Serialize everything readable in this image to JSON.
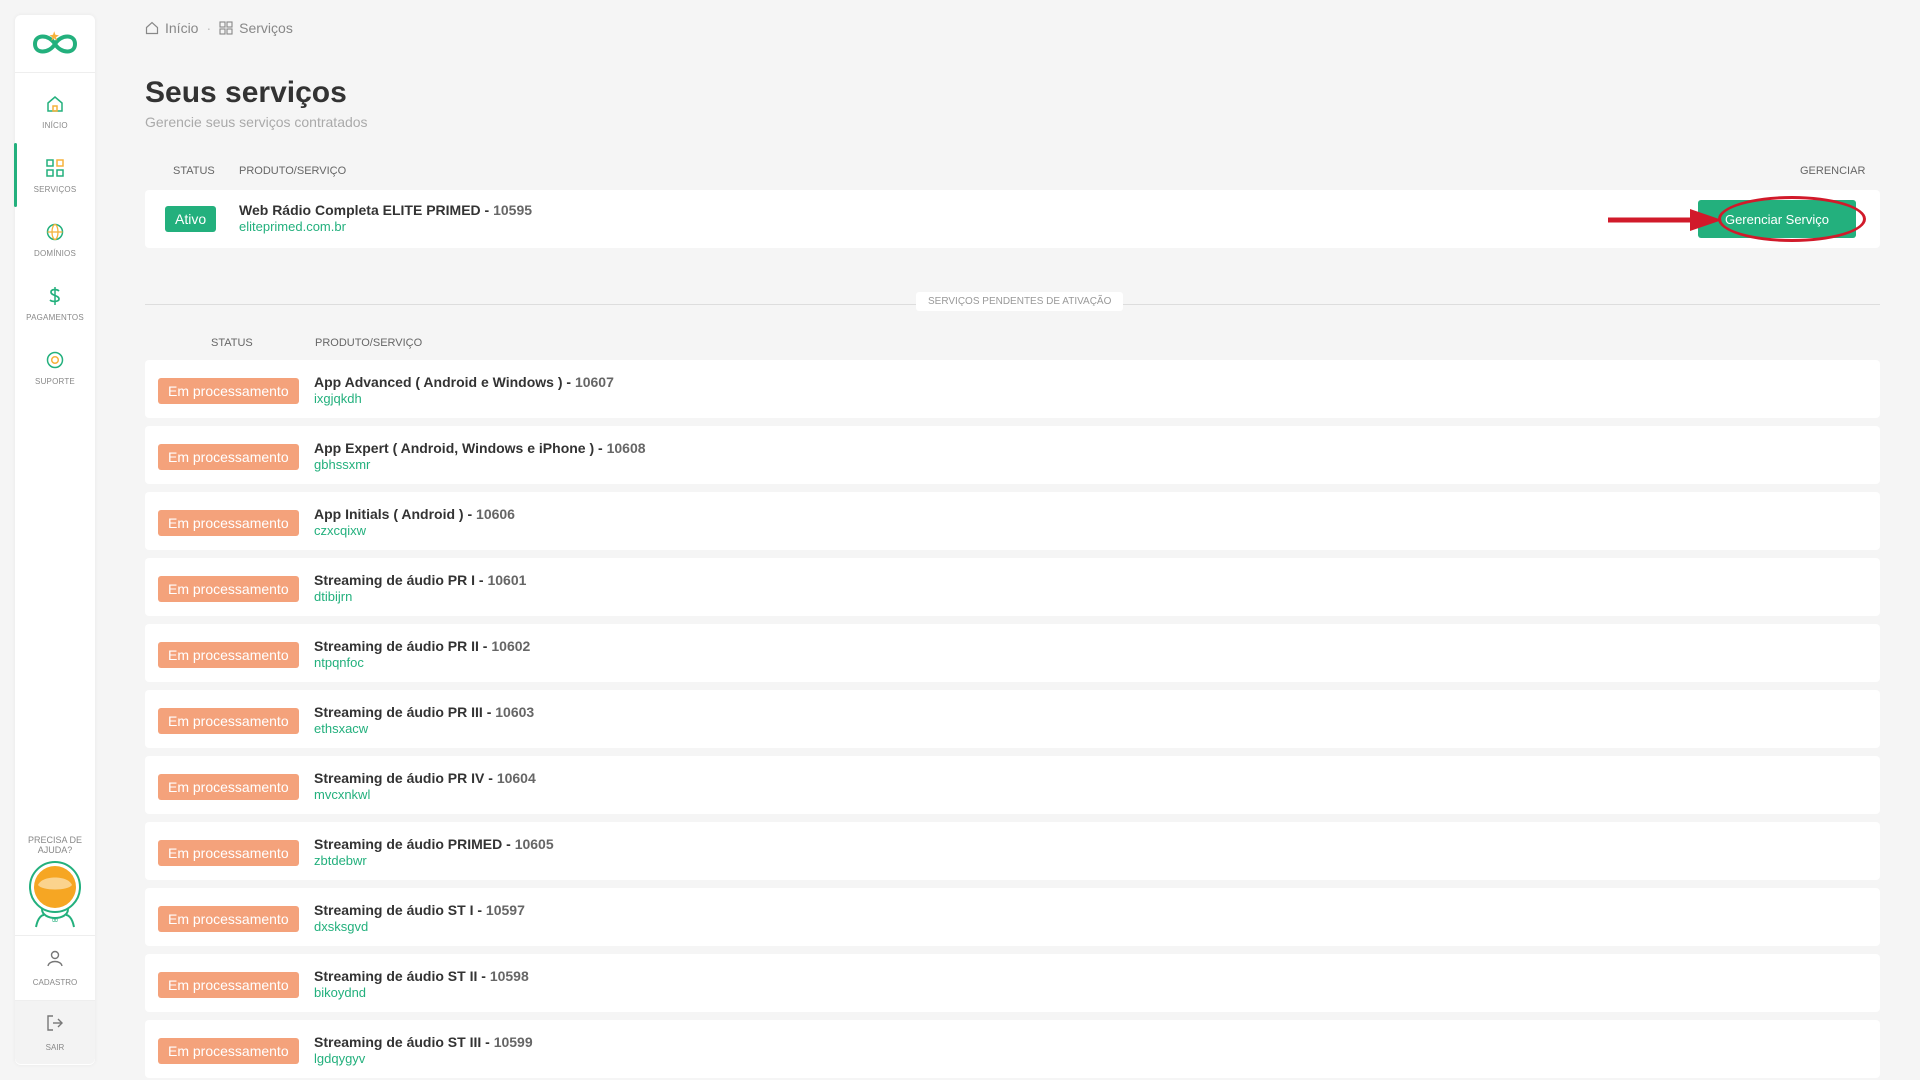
{
  "sidebar": {
    "items": [
      {
        "name": "inicio",
        "label": "INÍCIO",
        "icon": "home-icon"
      },
      {
        "name": "servicos",
        "label": "SERVIÇOS",
        "icon": "grid-icon"
      },
      {
        "name": "dominios",
        "label": "DOMÍNIOS",
        "icon": "globe-icon"
      },
      {
        "name": "pagamentos",
        "label": "PAGAMENTOS",
        "icon": "dollar-icon"
      },
      {
        "name": "suporte",
        "label": "SUPORTE",
        "icon": "lifebuoy-icon"
      }
    ],
    "help": "PRECISA DE AJUDA?",
    "cadastro": "CADASTRO",
    "sair": "SAIR"
  },
  "breadcrumb": {
    "home": "Início",
    "current": "Serviços"
  },
  "header": {
    "title": "Seus serviços",
    "subtitle": "Gerencie seus serviços contratados"
  },
  "active_table": {
    "col_status": "STATUS",
    "col_product": "PRODUTO/SERVIÇO",
    "col_manage": "GERENCIAR",
    "row": {
      "status": "Ativo",
      "name": "Web Rádio Completa ELITE PRIMED",
      "code": "10595",
      "domain": "eliteprimed.com.br",
      "button": "Gerenciar Serviço"
    }
  },
  "pending_label": "SERVIÇOS PENDENTES DE ATIVAÇÃO",
  "pending_table": {
    "col_status": "STATUS",
    "col_product": "PRODUTO/SERVIÇO",
    "rows": [
      {
        "status": "Em processamento",
        "name": "App Advanced ( Android e Windows )",
        "code": "10607",
        "domain": "ixgjqkdh"
      },
      {
        "status": "Em processamento",
        "name": "App Expert ( Android, Windows e iPhone )",
        "code": "10608",
        "domain": "gbhssxmr"
      },
      {
        "status": "Em processamento",
        "name": "App Initials ( Android )",
        "code": "10606",
        "domain": "czxcqixw"
      },
      {
        "status": "Em processamento",
        "name": "Streaming de áudio PR I",
        "code": "10601",
        "domain": "dtibijrn"
      },
      {
        "status": "Em processamento",
        "name": "Streaming de áudio PR II",
        "code": "10602",
        "domain": "ntpqnfoc"
      },
      {
        "status": "Em processamento",
        "name": "Streaming de áudio PR III",
        "code": "10603",
        "domain": "ethsxacw"
      },
      {
        "status": "Em processamento",
        "name": "Streaming de áudio PR IV",
        "code": "10604",
        "domain": "mvcxnkwl"
      },
      {
        "status": "Em processamento",
        "name": "Streaming de áudio PRIMED",
        "code": "10605",
        "domain": "zbtdebwr"
      },
      {
        "status": "Em processamento",
        "name": "Streaming de áudio ST I",
        "code": "10597",
        "domain": "dxsksgvd"
      },
      {
        "status": "Em processamento",
        "name": "Streaming de áudio ST II",
        "code": "10598",
        "domain": "bikoydnd"
      },
      {
        "status": "Em processamento",
        "name": "Streaming de áudio ST III",
        "code": "10599",
        "domain": "lgdqygyv"
      }
    ]
  },
  "colors": {
    "accent": "#23b07d",
    "pending": "#f4a27b",
    "annotation": "#d11a2a"
  }
}
